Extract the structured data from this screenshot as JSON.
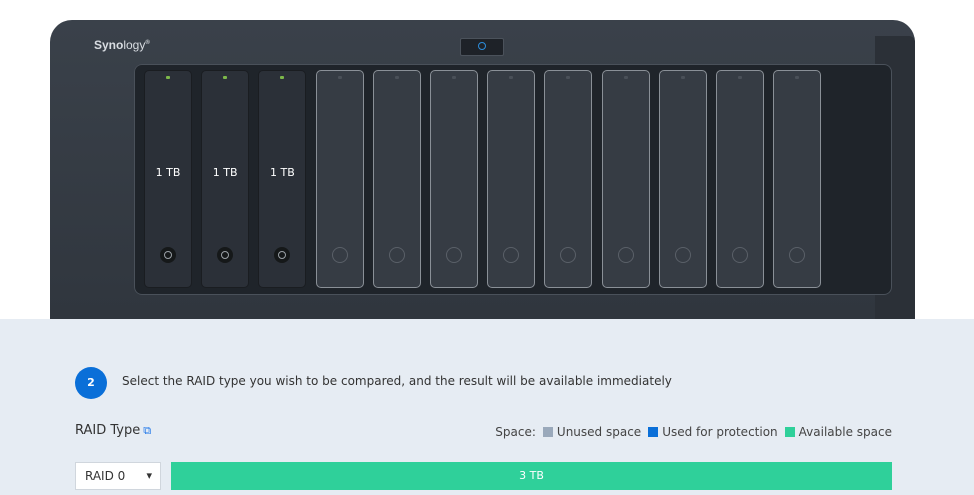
{
  "device": {
    "brand": "Synology",
    "brand_bold": "Syno",
    "brand_thin": "logy",
    "brand_mark": "®",
    "drives": [
      {
        "capacity": "1 TB",
        "installed": true
      },
      {
        "capacity": "1 TB",
        "installed": true
      },
      {
        "capacity": "1 TB",
        "installed": true
      },
      {
        "capacity": "",
        "installed": false
      },
      {
        "capacity": "",
        "installed": false
      },
      {
        "capacity": "",
        "installed": false
      },
      {
        "capacity": "",
        "installed": false
      },
      {
        "capacity": "",
        "installed": false
      },
      {
        "capacity": "",
        "installed": false
      },
      {
        "capacity": "",
        "installed": false
      },
      {
        "capacity": "",
        "installed": false
      },
      {
        "capacity": "",
        "installed": false
      }
    ]
  },
  "step": {
    "number": "2",
    "instruction": "Select the RAID type you wish to be compared, and the result will be available immediately"
  },
  "raid": {
    "title": "RAID Type",
    "title_icon": "external-link-icon",
    "selected": "RAID 0"
  },
  "legend": {
    "label": "Space:",
    "items": [
      {
        "label": "Unused space",
        "color": "#9aa9bb"
      },
      {
        "label": "Used for protection",
        "color": "#0a6fd8"
      },
      {
        "label": "Available space",
        "color": "#2fd09a"
      }
    ]
  },
  "result": {
    "available_label": "3 TB",
    "available_fraction": 1.0,
    "color": "#2fd09a"
  }
}
